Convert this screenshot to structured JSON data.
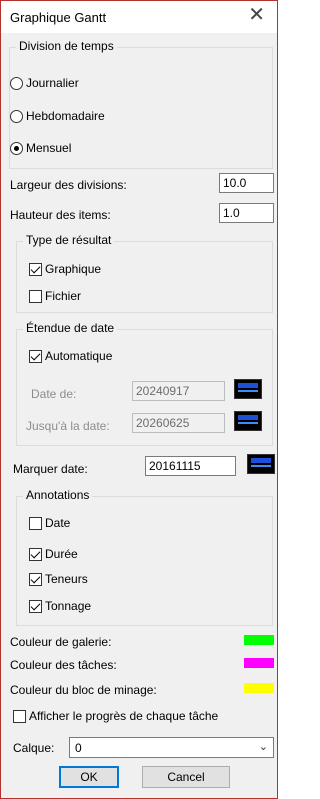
{
  "window": {
    "title": "Graphique Gantt",
    "close_glyph": "✕"
  },
  "time_division": {
    "label": "Division de  temps",
    "options": [
      {
        "label": "Journalier",
        "selected": false
      },
      {
        "label": "Hebdomadaire",
        "selected": false
      },
      {
        "label": "Mensuel",
        "selected": true
      }
    ]
  },
  "division_width": {
    "label": "Largeur des divisions:",
    "value": "10.0"
  },
  "item_height": {
    "label": "Hauteur des items:",
    "value": "1.0"
  },
  "result_type": {
    "label": "Type de résultat",
    "graphique": {
      "label": "Graphique",
      "checked": true
    },
    "fichier": {
      "label": "Fichier",
      "checked": false
    }
  },
  "date_range": {
    "label": "Étendue de date",
    "automatique": {
      "label": "Automatique",
      "checked": true
    },
    "date_from": {
      "label": "Date de:",
      "value": "20240917"
    },
    "date_to": {
      "label": "Jusqu'à la date:",
      "value": "20260625"
    }
  },
  "mark_date": {
    "label": "Marquer date:",
    "value": "20161115"
  },
  "annotations": {
    "label": "Annotations",
    "items": [
      {
        "label": "Date",
        "checked": false
      },
      {
        "label": "Durée",
        "checked": true
      },
      {
        "label": "Teneurs",
        "checked": true
      },
      {
        "label": "Tonnage",
        "checked": true
      }
    ]
  },
  "colors": {
    "gallery": {
      "label": "Couleur de galerie:",
      "color": "#00ff00"
    },
    "tasks": {
      "label": "Couleur des tâches:",
      "color": "#ff00ff"
    },
    "blast_block": {
      "label": "Couleur du bloc de minage:",
      "color": "#ffff00"
    }
  },
  "show_progress": {
    "label": "Afficher le progrès de chaque tâche",
    "checked": false
  },
  "layer": {
    "label": "Calque:",
    "value": "0"
  },
  "buttons": {
    "ok": "OK",
    "cancel": "Cancel"
  }
}
